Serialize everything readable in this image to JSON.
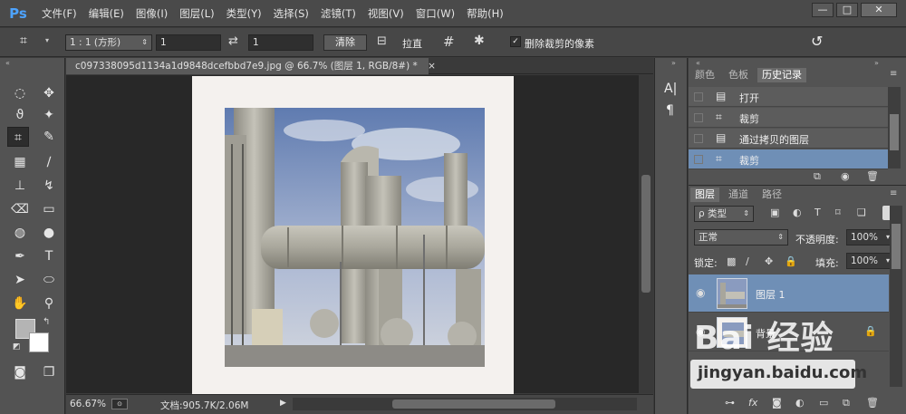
{
  "app": {
    "logo": "Ps"
  },
  "menus": [
    "文件(F)",
    "编辑(E)",
    "图像(I)",
    "图层(L)",
    "类型(Y)",
    "选择(S)",
    "滤镜(T)",
    "视图(V)",
    "窗口(W)",
    "帮助(H)"
  ],
  "window_controls": {
    "minimize": "—",
    "maximize": "□",
    "close": "✕"
  },
  "options": {
    "tool_icon": "crop-icon",
    "ratio_value": "1 : 1 (方形)",
    "width_value": "1",
    "height_value": "1",
    "clear_label": "清除",
    "straighten_label": "拉直",
    "delete_checkbox_label": "删除裁剪的像素",
    "delete_checked": true
  },
  "document": {
    "tab_title": "c097338095d1134a1d9848dcefbbd7e9.jpg @ 66.7% (图层 1, RGB/8#) *",
    "close": "×"
  },
  "status": {
    "zoom": "66.67%",
    "doc_info": "文档:905.7K/2.06M"
  },
  "history_panel": {
    "tabs": [
      "颜色",
      "色板",
      "历史记录"
    ],
    "active_tab": 2,
    "rows": [
      {
        "icon": "document-icon",
        "label": "打开"
      },
      {
        "icon": "crop-icon",
        "label": "裁剪"
      },
      {
        "icon": "document-icon",
        "label": "通过拷贝的图层"
      },
      {
        "icon": "crop-icon",
        "label": "裁剪"
      }
    ],
    "selected_row": 3
  },
  "layers_panel": {
    "tabs": [
      "图层",
      "通道",
      "路径"
    ],
    "active_tab": 0,
    "filter_label": "ρ 类型",
    "blend_mode": "正常",
    "opacity_label": "不透明度:",
    "opacity_value": "100%",
    "lock_label": "锁定:",
    "fill_label": "填充:",
    "fill_value": "100%",
    "layers": [
      {
        "name": "图层 1",
        "selected": true,
        "locked": false
      },
      {
        "name": "背景",
        "selected": false,
        "locked": true
      }
    ]
  },
  "watermark": {
    "brand": "Bai  经验",
    "url": "jingyan.baidu.com"
  },
  "colors": {
    "accent": "#6f8fb6",
    "ps_blue": "#4da3ff"
  }
}
